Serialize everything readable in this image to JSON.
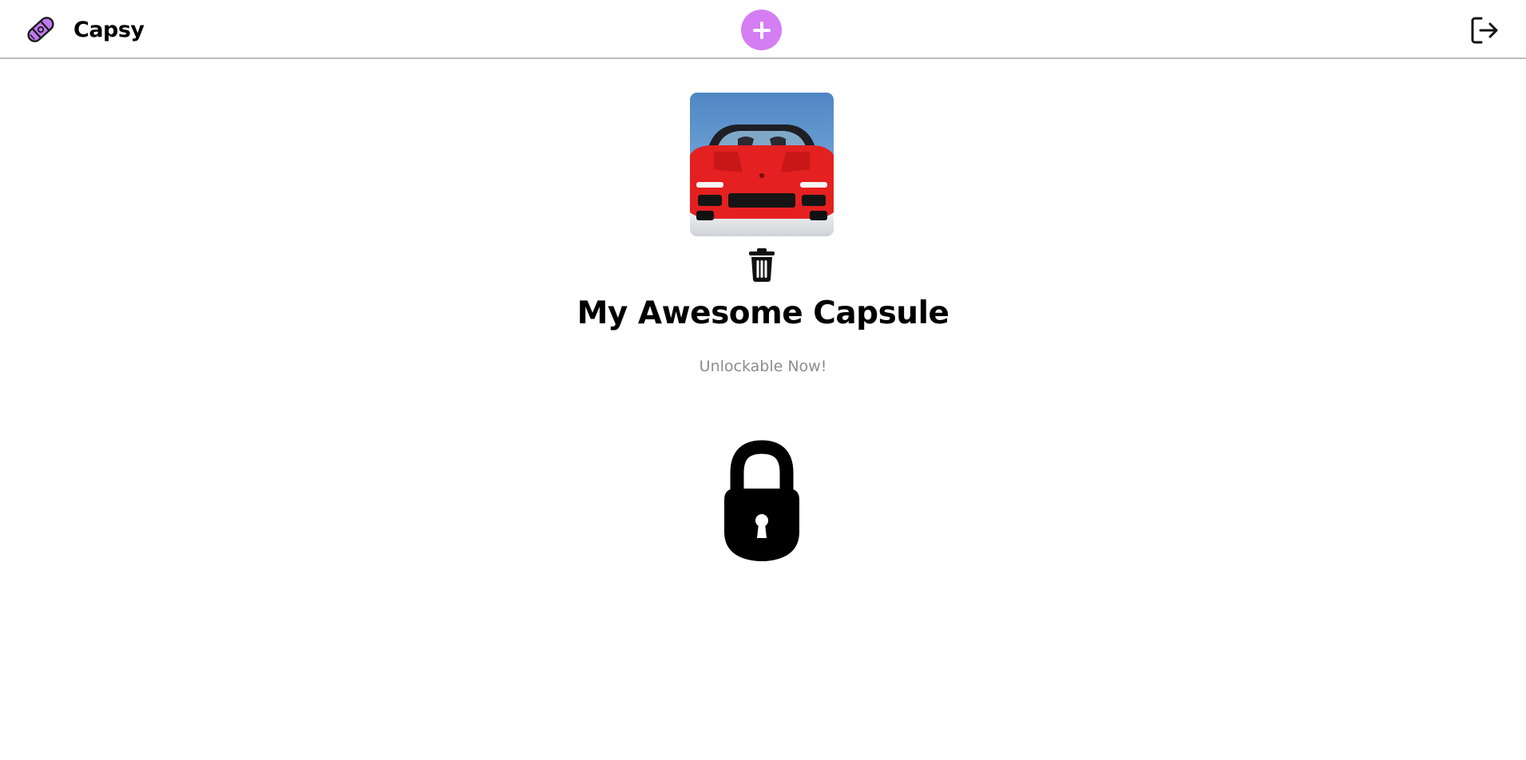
{
  "app": {
    "name": "Capsy",
    "logo_icon": "crayon-capsule-icon",
    "accent_color": "#d57ef3"
  },
  "header": {
    "add_button_icon": "plus-icon",
    "logout_icon": "logout-icon"
  },
  "capsule": {
    "image_icon": "red-sports-car-photo",
    "delete_icon": "trash-icon",
    "title": "My Awesome Capsule",
    "status": "Unlockable Now!",
    "lock_icon": "padlock-icon"
  }
}
